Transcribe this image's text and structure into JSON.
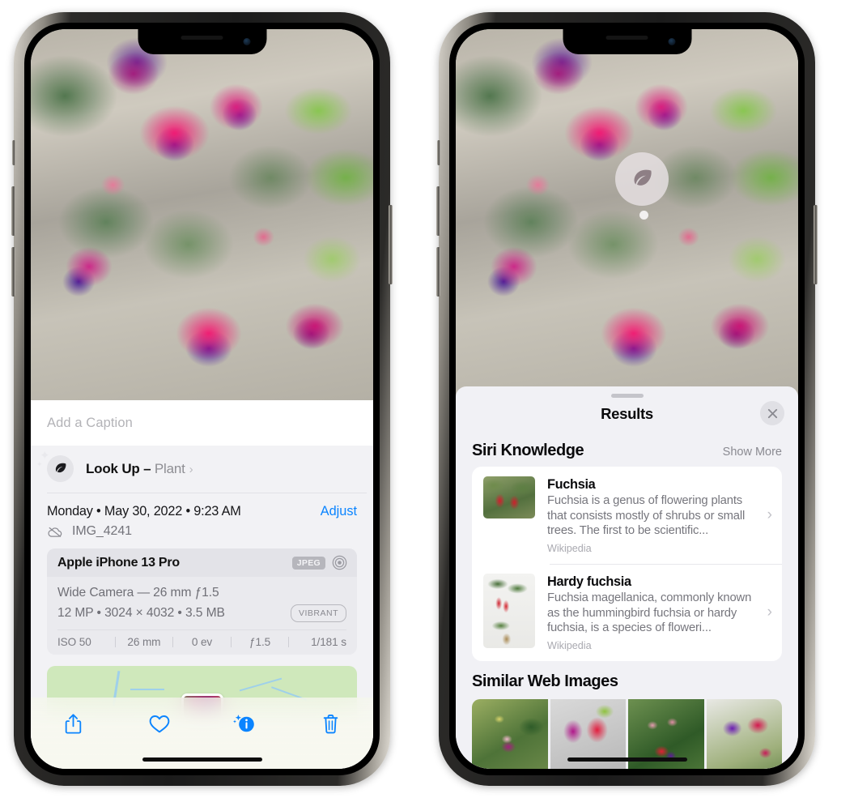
{
  "left_phone": {
    "photo": {
      "alt": "fuchsia-flowers-photo"
    },
    "caption_placeholder": "Add a Caption",
    "lookup": {
      "label": "Look Up – ",
      "kind": "Plant",
      "chevron": "›",
      "icon": "leaf-icon",
      "sparkle": "✦"
    },
    "date": "Monday • May 30, 2022 • 9:23 AM",
    "adjust": "Adjust",
    "filename": "IMG_4241",
    "cloud_icon": "cloud-slash-icon",
    "camera": {
      "device": "Apple iPhone 13 Pro",
      "format_tag": "JPEG",
      "hdr_icon": "hdr-target-icon",
      "lens_line": "Wide Camera — 26 mm ƒ1.5",
      "specs_line": "12 MP • 3024 × 4032 • 3.5 MB",
      "style_tag": "VIBRANT",
      "exif": [
        "ISO 50",
        "26 mm",
        "0 ev",
        "ƒ1.5",
        "1/181 s"
      ]
    },
    "toolbar": [
      {
        "name": "share-button",
        "icon": "share-icon"
      },
      {
        "name": "favorite-button",
        "icon": "heart-icon"
      },
      {
        "name": "info-button",
        "icon": "info-sparkle-icon"
      },
      {
        "name": "delete-button",
        "icon": "trash-icon"
      }
    ],
    "accent_color": "#0a84ff"
  },
  "right_phone": {
    "marker": {
      "icon": "leaf-icon"
    },
    "sheet": {
      "title": "Results",
      "close_icon": "close-icon",
      "sections": [
        {
          "title": "Siri Knowledge",
          "action": "Show More",
          "items": [
            {
              "title": "Fuchsia",
              "description": "Fuchsia is a genus of flowering plants that consists mostly of shrubs or small trees. The first to be scientific...",
              "source": "Wikipedia",
              "chevron": "›",
              "thumb": "fuchsia-thumbnail"
            },
            {
              "title": "Hardy fuchsia",
              "description": "Fuchsia magellanica, commonly known as the hummingbird fuchsia or hardy fuchsia, is a species of floweri...",
              "source": "Wikipedia",
              "chevron": "›",
              "thumb": "hardy-fuchsia-thumbnail"
            }
          ]
        },
        {
          "title": "Similar Web Images",
          "images": [
            "web-image-1",
            "web-image-2",
            "web-image-3",
            "web-image-4"
          ]
        }
      ]
    }
  }
}
